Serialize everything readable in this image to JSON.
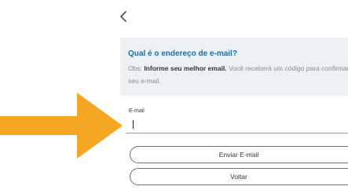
{
  "back_icon": "chevron-left-icon",
  "info_panel": {
    "title": "Qual é o endereço de e-mail?",
    "obs_prefix": "Obs: ",
    "obs_bold": "Informe seu melhor email.",
    "obs_rest": " Você receberá um código para confirmar seu e-mail."
  },
  "email_field": {
    "label": "E-mail",
    "value": ""
  },
  "buttons": {
    "send_label": "Enviar E-mail",
    "back_label": "Voltar"
  },
  "pointer_arrow": {
    "icon": "arrow-right-icon",
    "color": "#f5a623"
  },
  "colors": {
    "title": "#1a6eb0",
    "panel_bg": "#eef1f4"
  }
}
